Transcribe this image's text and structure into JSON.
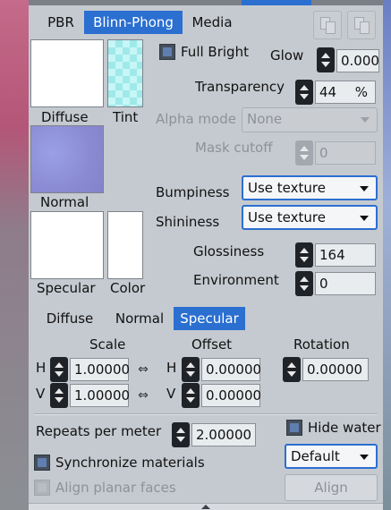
{
  "tabs": {
    "pbr": "PBR",
    "blinn_phong": "Blinn-Phong",
    "media": "Media",
    "active": "Blinn-Phong"
  },
  "swatches": {
    "diffuse": "Diffuse",
    "tint": "Tint",
    "normal": "Normal",
    "specular": "Specular",
    "color": "Color"
  },
  "options": {
    "full_bright": "Full Bright",
    "glow_label": "Glow",
    "glow_value": "0.000",
    "transparency_label": "Transparency",
    "transparency_value": "44",
    "transparency_unit": "%",
    "alpha_mode_label": "Alpha mode",
    "alpha_mode_value": "None",
    "mask_cutoff_label": "Mask cutoff",
    "mask_cutoff_value": "0",
    "bumpiness_label": "Bumpiness",
    "bumpiness_value": "Use texture",
    "shininess_label": "Shininess",
    "shininess_value": "Use texture",
    "glossiness_label": "Glossiness",
    "glossiness_value": "164",
    "environment_label": "Environment",
    "environment_value": "0"
  },
  "map_tabs": {
    "diffuse": "Diffuse",
    "normal": "Normal",
    "specular": "Specular",
    "active": "Specular"
  },
  "transform": {
    "scale_label": "Scale",
    "offset_label": "Offset",
    "rotation_label": "Rotation",
    "h": "H",
    "v": "V",
    "scale_h": "1.00000",
    "scale_v": "1.00000",
    "offset_h": "0.00000",
    "offset_v": "0.00000",
    "rotation": "0.00000"
  },
  "bottom": {
    "repeats_label": "Repeats per meter",
    "repeats_value": "2.00000",
    "hide_water": "Hide water",
    "sync_materials": "Synchronize materials",
    "align_planar": "Align planar faces",
    "default_combo": "Default",
    "align_button": "Align"
  },
  "colors": {
    "accent": "#2b6fd0",
    "panel": "#c5cad0",
    "tint": "#a6f0f0",
    "normal_map": "#8e8fd8"
  }
}
